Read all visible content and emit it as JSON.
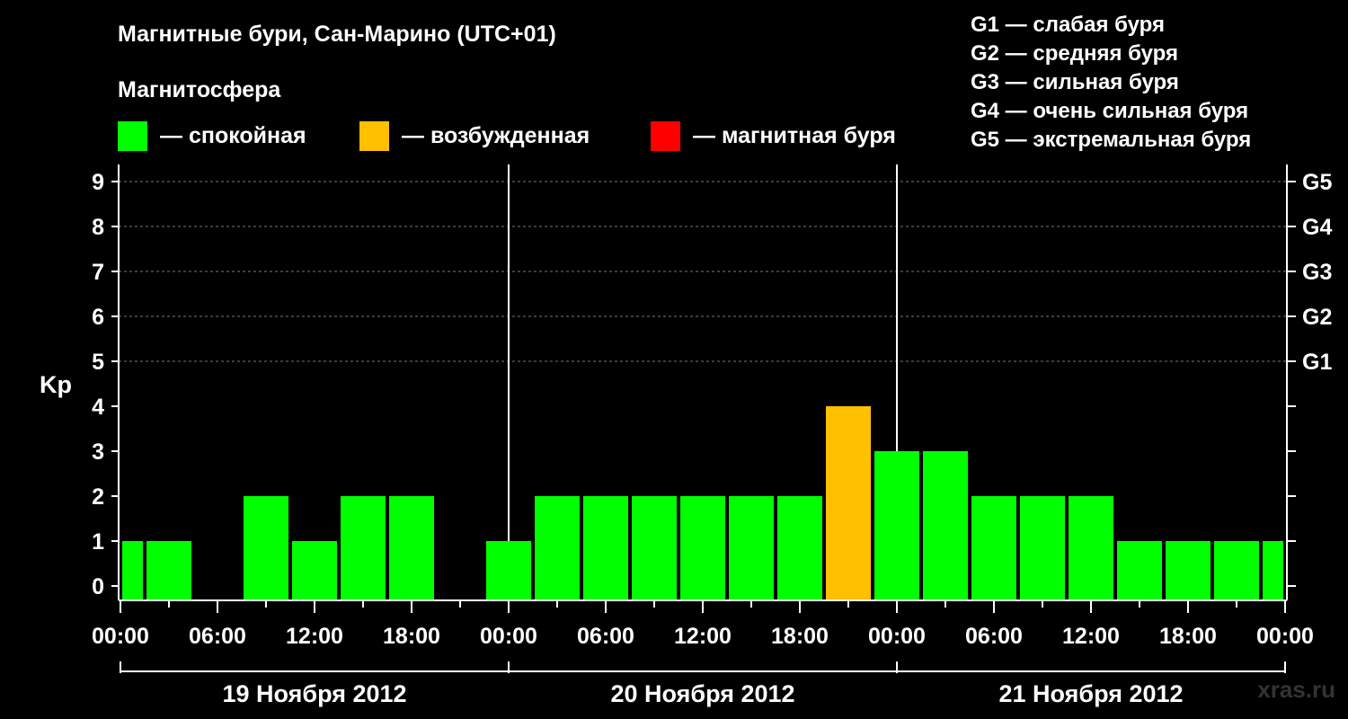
{
  "header": {
    "title": "Магнитные бури, Сан-Марино (UTC+01)",
    "subtitle": "Магнитосфера"
  },
  "legend": {
    "items": [
      {
        "label": "— спокойная",
        "color": "#00ff00"
      },
      {
        "label": "— возбужденная",
        "color": "#ffc000"
      },
      {
        "label": "— магнитная буря",
        "color": "#ff0000"
      }
    ]
  },
  "g_scale": [
    "G1 — слабая буря",
    "G2 — средняя буря",
    "G3 — сильная буря",
    "G4 — очень сильная буря",
    "G5 — экстремальная буря"
  ],
  "watermark": "xras.ru",
  "chart_data": {
    "type": "bar",
    "ylabel": "Kp",
    "ylim": [
      0,
      9
    ],
    "y_ticks": [
      "0",
      "1",
      "2",
      "3",
      "4",
      "5",
      "6",
      "7",
      "8",
      "9"
    ],
    "g_ticks": [
      {
        "kp": 5,
        "label": "G1"
      },
      {
        "kp": 6,
        "label": "G2"
      },
      {
        "kp": 7,
        "label": "G3"
      },
      {
        "kp": 8,
        "label": "G4"
      },
      {
        "kp": 9,
        "label": "G5"
      }
    ],
    "x_tick_labels": [
      "00:00",
      "06:00",
      "12:00",
      "18:00",
      "00:00",
      "06:00",
      "12:00",
      "18:00",
      "00:00",
      "06:00",
      "12:00",
      "18:00",
      "00:00"
    ],
    "days": [
      "19 Ноября 2012",
      "20 Ноября 2012",
      "21 Ноября 2012"
    ],
    "bar_interval_hours": 3,
    "series": [
      {
        "values": [
          1,
          1,
          0,
          2,
          1,
          2,
          2,
          0,
          1,
          2,
          2,
          2,
          2,
          2,
          2,
          4,
          3,
          3,
          2,
          2,
          2,
          1,
          1,
          1,
          1
        ]
      }
    ],
    "first_bar_partial": true,
    "last_bar_partial": true,
    "colors": {
      "calm": "#00ff00",
      "active": "#ffc000",
      "storm": "#ff0000"
    },
    "grid": "dashed at G-levels 5-9"
  }
}
